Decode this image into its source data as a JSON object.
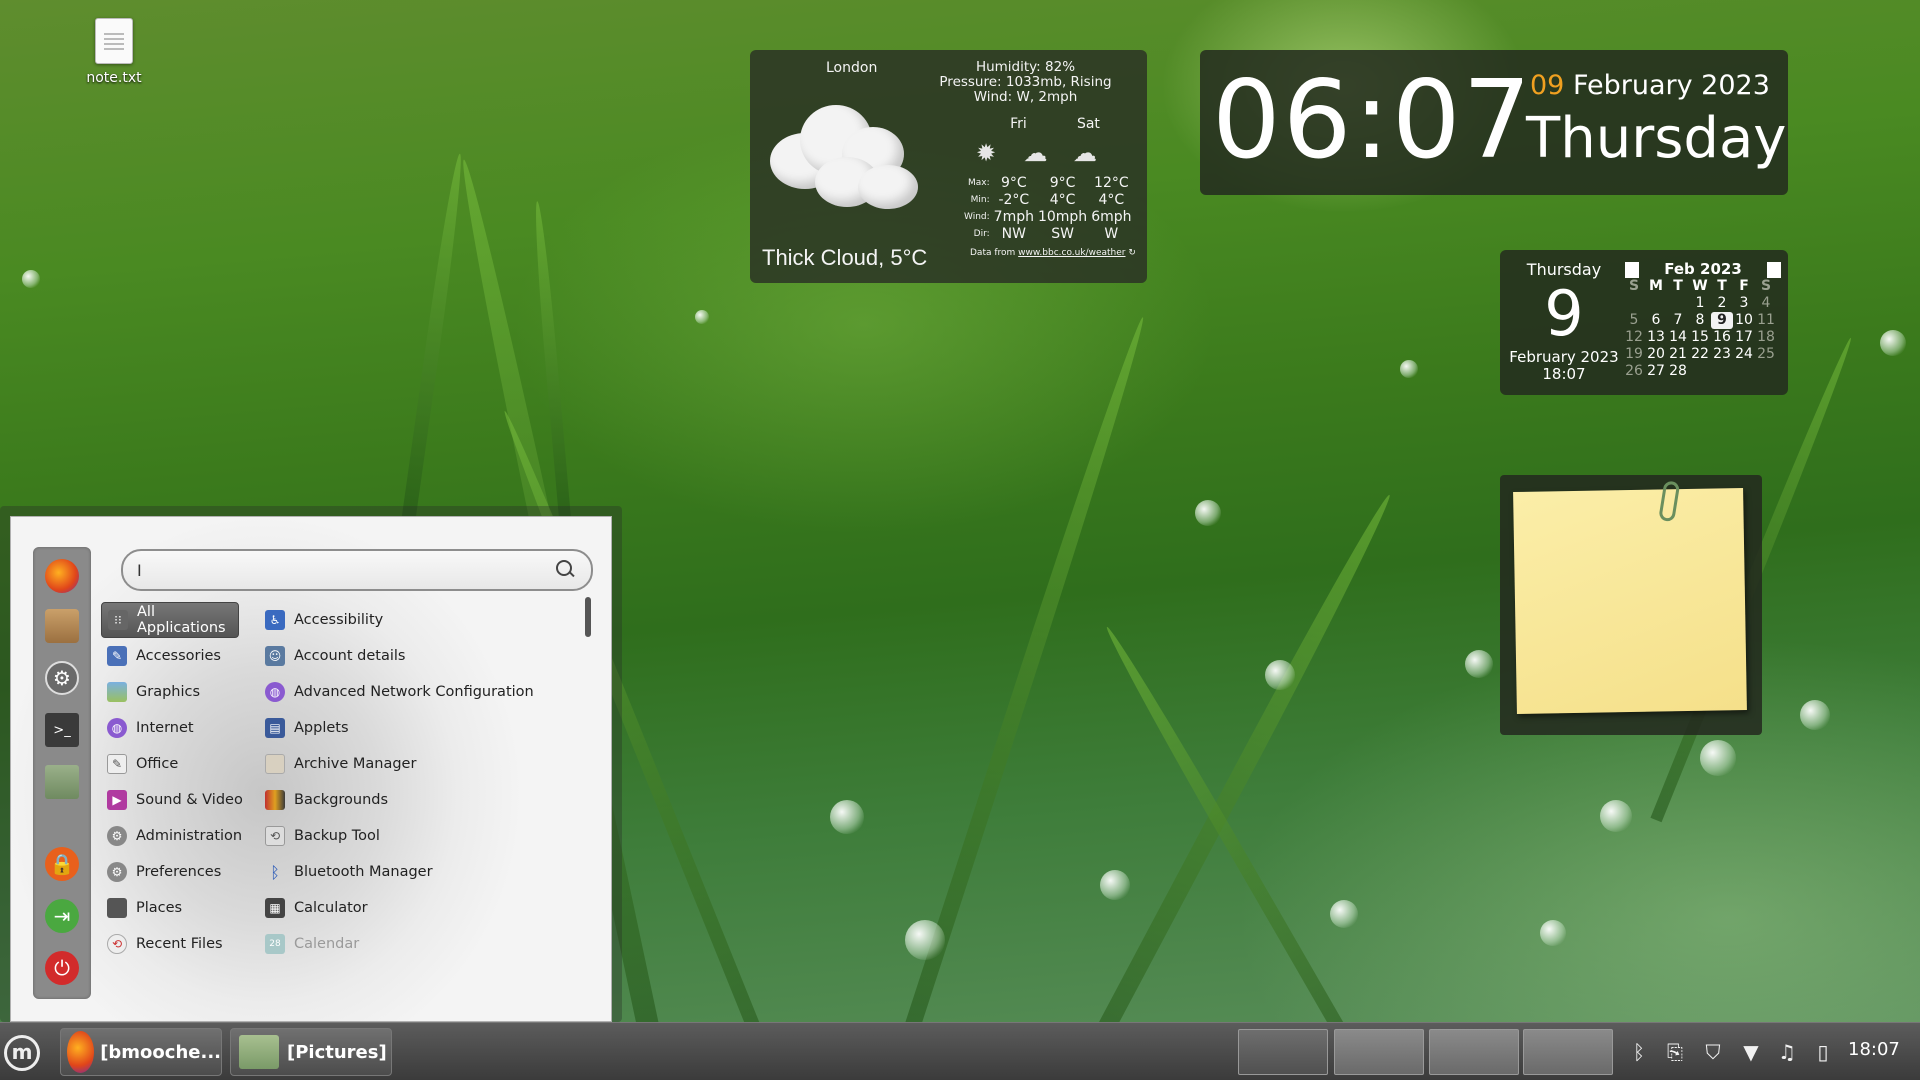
{
  "desktop": {
    "icon_label": "note.txt"
  },
  "weather": {
    "city": "London",
    "humidity": "Humidity: 82%",
    "pressure": "Pressure: 1033mb, Rising",
    "wind": "Wind: W, 2mph",
    "condition": "Thick Cloud, 5°C",
    "forecast_days": [
      "Fri",
      "Sat"
    ],
    "row_labels": {
      "max": "Max:",
      "min": "Min:",
      "wind": "Wind:",
      "dir": "Dir:"
    },
    "today": {
      "max": "9°C",
      "min": "-2°C",
      "wind": "7mph",
      "dir": "NW"
    },
    "fri": {
      "max": "9°C",
      "min": "4°C",
      "wind": "10mph",
      "dir": "SW"
    },
    "sat": {
      "max": "12°C",
      "min": "4°C",
      "wind": "6mph",
      "dir": "W"
    },
    "source_prefix": "Data from ",
    "source_link": "www.bbc.co.uk/weather"
  },
  "clock": {
    "time": "06:07",
    "day_num": "09",
    "month_year": " February 2023",
    "weekday": "Thursday"
  },
  "calendar": {
    "weekday": "Thursday",
    "day": "9",
    "month_year": "February 2023",
    "time": "18:07",
    "header": "Feb 2023",
    "dow": [
      "S",
      "M",
      "T",
      "W",
      "T",
      "F",
      "S"
    ],
    "rows": [
      [
        "",
        "",
        "",
        "1",
        "2",
        "3",
        "4"
      ],
      [
        "5",
        "6",
        "7",
        "8",
        "9",
        "10",
        "11"
      ],
      [
        "12",
        "13",
        "14",
        "15",
        "16",
        "17",
        "18"
      ],
      [
        "19",
        "20",
        "21",
        "22",
        "23",
        "24",
        "25"
      ],
      [
        "26",
        "27",
        "28",
        "",
        "",
        "",
        ""
      ]
    ],
    "today": "9"
  },
  "menu": {
    "search_value": "I",
    "favorites": [
      "firefox-icon",
      "software-manager-icon",
      "settings-icon",
      "terminal-icon",
      "files-icon",
      "lock-icon",
      "logout-icon",
      "power-icon"
    ],
    "categories": [
      {
        "label": "All Applications",
        "icon": "grid-icon"
      },
      {
        "label": "Accessories",
        "icon": "accessories-icon"
      },
      {
        "label": "Graphics",
        "icon": "graphics-icon"
      },
      {
        "label": "Internet",
        "icon": "internet-icon"
      },
      {
        "label": "Office",
        "icon": "office-icon"
      },
      {
        "label": "Sound & Video",
        "icon": "sound-video-icon"
      },
      {
        "label": "Administration",
        "icon": "administration-icon"
      },
      {
        "label": "Preferences",
        "icon": "preferences-icon"
      },
      {
        "label": "Places",
        "icon": "folder-icon"
      },
      {
        "label": "Recent Files",
        "icon": "recent-icon"
      }
    ],
    "apps": [
      {
        "label": "Accessibility",
        "icon": "accessibility-icon"
      },
      {
        "label": "Account details",
        "icon": "account-icon"
      },
      {
        "label": "Advanced Network Configuration",
        "icon": "network-icon"
      },
      {
        "label": "Applets",
        "icon": "applets-icon"
      },
      {
        "label": "Archive Manager",
        "icon": "archive-icon"
      },
      {
        "label": "Backgrounds",
        "icon": "backgrounds-icon"
      },
      {
        "label": "Backup Tool",
        "icon": "backup-icon"
      },
      {
        "label": "Bluetooth Manager",
        "icon": "bluetooth-icon"
      },
      {
        "label": "Calculator",
        "icon": "calculator-icon"
      },
      {
        "label": "Calendar",
        "icon": "calendar-icon"
      }
    ]
  },
  "taskbar": {
    "firefox_task": "[bmooche...",
    "files_task": "[Pictures]",
    "clock": "18:07"
  }
}
